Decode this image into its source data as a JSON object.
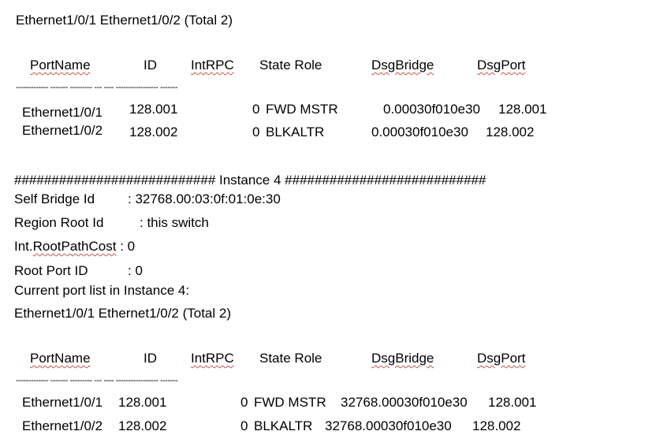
{
  "block1": {
    "port_list": "Ethernet1/0/1 Ethernet1/0/2 (Total 2)",
    "headers": {
      "portname": "PortName",
      "id": "ID",
      "intrpc": "IntRPC",
      "state_role": "State Role",
      "dsgbridge": "DsgBridge",
      "dsgport": "DsgPort"
    },
    "dashes": "------------- ------- --------- --- ---- ----------------- -------",
    "rows": [
      {
        "port": "Ethernet1/0/1",
        "id": "128.001",
        "intrpc": "0",
        "state_role": "FWD MSTR",
        "dsgbridge": "0.00030f010e30",
        "dsgport": "128.001"
      },
      {
        "port": "Ethernet1/0/2",
        "id": "128.002",
        "intrpc": "0",
        "state_role": "BLKALTR",
        "dsgbridge": "0.00030f010e30",
        "dsgport": "128.002"
      }
    ]
  },
  "instance": {
    "banner": "########################### Instance 4 ###########################",
    "self_bridge_label": "Self Bridge Id",
    "self_bridge_value": ": 32768.00:03:0f:01:0e:30",
    "region_root_label": "Region Root Id",
    "region_root_value": ": this switch",
    "root_path_cost_prefix": "Int.",
    "root_path_cost_label": "RootPathCost",
    "root_path_cost_value": ": 0",
    "root_port_label": "Root Port ID",
    "root_port_value": ": 0",
    "current_port_list": "Current port list in Instance 4:"
  },
  "block2": {
    "port_list": "Ethernet1/0/1 Ethernet1/0/2 (Total 2)",
    "headers": {
      "portname": "PortName",
      "id": "ID",
      "intrpc": "IntRPC",
      "state_role": "State Role",
      "dsgbridge": "DsgBridge",
      "dsgport": "DsgPort"
    },
    "dashes": "------------- ------- --------- --- ---- ----------------- -------",
    "rows": [
      {
        "port": "Ethernet1/0/1",
        "id": "128.001",
        "intrpc": "0",
        "state_role": "FWD MSTR",
        "dsgbridge": "32768.00030f010e30",
        "dsgport": "128.001"
      },
      {
        "port": "Ethernet1/0/2",
        "id": "128.002",
        "intrpc": "0",
        "state_role": "BLKALTR",
        "dsgbridge": "32768.00030f010e30",
        "dsgport": "128.002"
      }
    ]
  }
}
